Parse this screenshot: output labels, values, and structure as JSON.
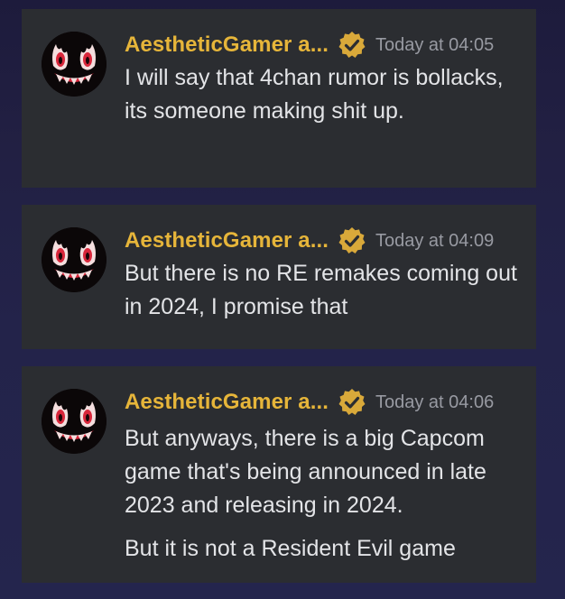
{
  "messages": [
    {
      "author": "AestheticGamer a...",
      "timestamp": "Today at 04:05",
      "avatar_icon": "demon-face-avatar",
      "badge_icon": "verified-check-badge",
      "paragraphs": [
        "I will say that 4chan rumor is bollacks, its someone making shit up."
      ]
    },
    {
      "author": "AestheticGamer a...",
      "timestamp": "Today at 04:09",
      "avatar_icon": "demon-face-avatar",
      "badge_icon": "verified-check-badge",
      "paragraphs": [
        "But there is no RE remakes coming out in 2024, I promise that"
      ]
    },
    {
      "author": "AestheticGamer a...",
      "timestamp": "Today at 04:06",
      "avatar_icon": "demon-face-avatar",
      "badge_icon": "verified-check-badge",
      "paragraphs": [
        "But anyways, there is a big Capcom game that's being announced in late 2023 and releasing in 2024.",
        "But it is not a Resident Evil game"
      ]
    }
  ],
  "colors": {
    "author": "#e6b53a",
    "badge": "#d9a93a",
    "card": "#2b2d31",
    "text": "#e3e4e7",
    "timestamp": "#989aa2"
  }
}
